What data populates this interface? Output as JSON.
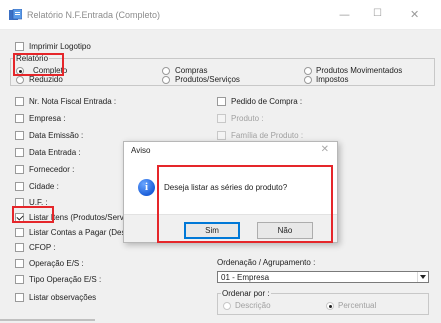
{
  "window": {
    "title": "Relatório N.F.Entrada (Completo)",
    "minimize": "—",
    "maximize": "☐",
    "close": "✕"
  },
  "logo_checkbox": {
    "label": "Imprimir Logotipo",
    "checked": false
  },
  "relatorio": {
    "group_label": "Relatório",
    "options": [
      {
        "label": "Completo",
        "checked": true
      },
      {
        "label": "Reduzido",
        "checked": false
      },
      {
        "label": "Compras",
        "checked": false
      },
      {
        "label": "Produtos/Serviços",
        "checked": false
      },
      {
        "label": "Produtos Movimentados",
        "checked": false
      },
      {
        "label": "Impostos",
        "checked": false
      }
    ]
  },
  "filters_left": [
    {
      "label": "Nr. Nota Fiscal Entrada :",
      "checked": false
    },
    {
      "label": "Empresa :",
      "checked": false
    },
    {
      "label": "Data Emissão :",
      "checked": false
    },
    {
      "label": "Data Entrada :",
      "checked": false
    },
    {
      "label": "Fornecedor :",
      "checked": false
    },
    {
      "label": "Cidade :",
      "checked": false
    },
    {
      "label": "U.F. :",
      "checked": false
    },
    {
      "label": "Listar Itens (Produtos/Serviço",
      "checked": true
    },
    {
      "label": "Listar Contas a Pagar (Despe",
      "checked": false
    },
    {
      "label": "CFOP :",
      "checked": false
    },
    {
      "label": "Operação E/S :",
      "checked": false
    },
    {
      "label": "Tipo Operação E/S :",
      "checked": false
    },
    {
      "label": "Listar observações",
      "checked": false
    }
  ],
  "filters_right": [
    {
      "label": "Pedido de Compra :",
      "checked": false,
      "disabled": false
    },
    {
      "label": "Produto :",
      "checked": false,
      "disabled": true
    },
    {
      "label": "Família de Produto :",
      "checked": false,
      "disabled": true
    }
  ],
  "ordenacao": {
    "label": "Ordenação / Agrupamento :",
    "value": "01 - Empresa"
  },
  "ordenar_por": {
    "group_label": "Ordenar por :",
    "options": [
      {
        "label": "Descrição",
        "checked": false
      },
      {
        "label": "Percentual",
        "checked": true
      }
    ]
  },
  "dialog": {
    "title": "Aviso",
    "close": "✕",
    "icon": "i",
    "message": "Deseja listar as séries do produto?",
    "yes": "Sim",
    "no": "Não"
  },
  "colors": {
    "highlight": "#e5262a",
    "dialog_default_border": "#0078d7",
    "info_icon": "#1c5fd9"
  }
}
